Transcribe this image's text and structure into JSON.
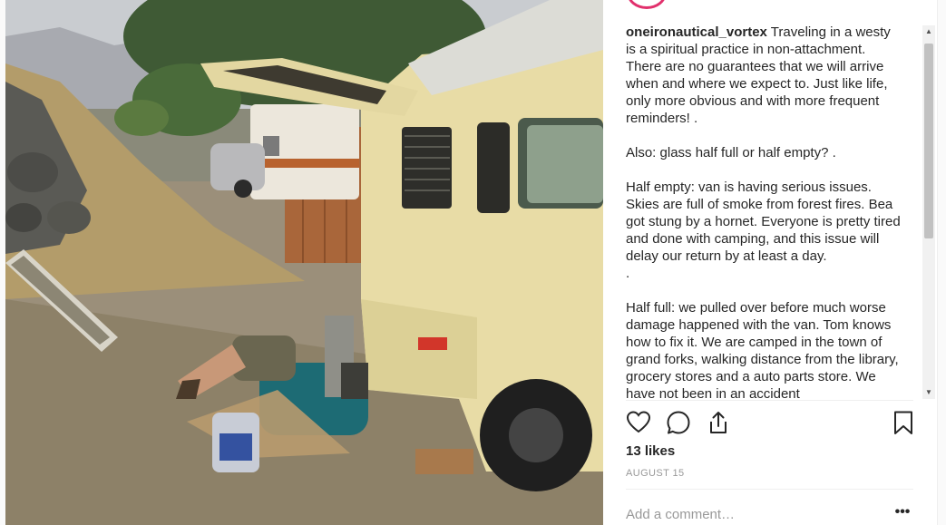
{
  "post": {
    "username": "oneironautical_vortex",
    "caption_paragraphs": [
      "Traveling in a westy is a spiritual practice in non-attachment. There are no guarantees that we will arrive when and where we expect to. Just like life, only more obvious and with more frequent reminders! .",
      "Also: glass half full or half empty? .",
      "Half empty: van is having serious issues. Skies are full of smoke from forest fires. Bea got stung by a hornet. Everyone is pretty tired and done with camping, and this issue will delay our return by at least a day.",
      ".",
      "Half full: we pulled over before much worse damage happened with the van. Tom knows how to fix it. We are camped in the town of grand forks, walking distance from the library, grocery stores and a auto parts store. We have not been in an accident"
    ],
    "likes": "13 likes",
    "date": "AUGUST 15",
    "comment_placeholder": "Add a comment…",
    "more_label": "•••"
  },
  "icons": {
    "like": "heart-icon",
    "comment": "comment-bubble-icon",
    "share": "share-icon",
    "save": "bookmark-icon",
    "scroll_up": "arrow-up-icon",
    "scroll_down": "arrow-down-icon"
  },
  "colors": {
    "text": "#262626",
    "muted": "#999999",
    "divider": "#efefef",
    "avatar_ring": "#e1306c"
  }
}
